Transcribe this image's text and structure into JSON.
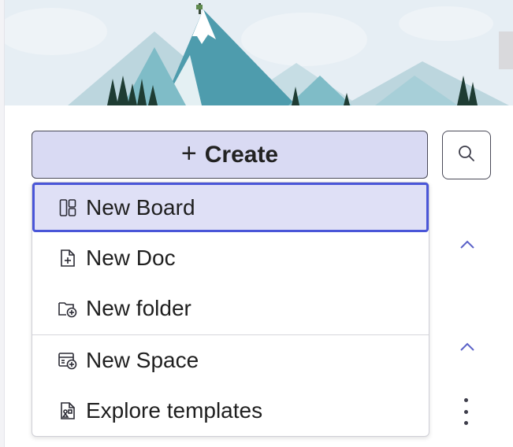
{
  "create_button": {
    "plus": "+",
    "label": "Create"
  },
  "icons": {
    "search": "search-icon",
    "chevron_up": "chevron-up-icon",
    "more": "kebab-icon"
  },
  "menu": {
    "items": [
      {
        "label": "New Board",
        "icon": "board-icon",
        "state": "hovered"
      },
      {
        "label": "New Doc",
        "icon": "doc-icon"
      },
      {
        "label": "New folder",
        "icon": "folder-add-icon"
      },
      {
        "label": "New Space",
        "icon": "space-add-icon"
      },
      {
        "label": "Explore templates",
        "icon": "templates-icon"
      }
    ]
  },
  "colors": {
    "accent": "#4a56d8",
    "create_bg": "#d9daf3",
    "hover_bg": "#dfe0f6",
    "chevron": "#5b62c8"
  }
}
